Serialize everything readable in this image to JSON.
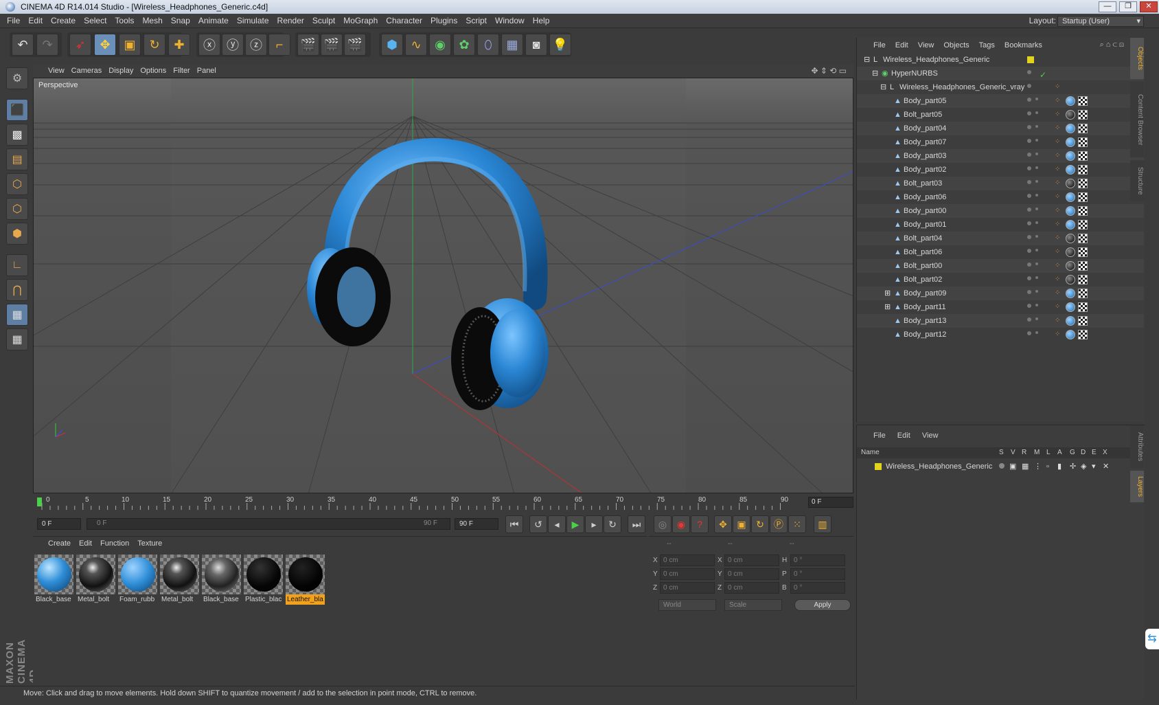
{
  "window": {
    "title": "CINEMA 4D R14.014 Studio - [Wireless_Headphones_Generic.c4d]",
    "minimize": "—",
    "maximize": "❐",
    "close": "✕"
  },
  "menu": [
    "File",
    "Edit",
    "Create",
    "Select",
    "Tools",
    "Mesh",
    "Snap",
    "Animate",
    "Simulate",
    "Render",
    "Sculpt",
    "MoGraph",
    "Character",
    "Plugins",
    "Script",
    "Window",
    "Help"
  ],
  "layout": {
    "label": "Layout:",
    "value": "Startup (User)"
  },
  "viewport": {
    "menu": [
      "View",
      "Cameras",
      "Display",
      "Options",
      "Filter",
      "Panel"
    ],
    "label": "Perspective"
  },
  "timeline": {
    "ticks": [
      "0",
      "5",
      "10",
      "15",
      "20",
      "25",
      "30",
      "35",
      "40",
      "45",
      "50",
      "55",
      "60",
      "65",
      "70",
      "75",
      "80",
      "85",
      "90"
    ],
    "current_frame": "0 F"
  },
  "transport": {
    "start": "0 F",
    "range_start": "0 F",
    "range_end": "90 F",
    "end": "90 F"
  },
  "materials": {
    "menu": [
      "Create",
      "Edit",
      "Function",
      "Texture"
    ],
    "items": [
      {
        "name": "Black_base",
        "color": "#2f8fd8"
      },
      {
        "name": "Metal_bolt",
        "color": "#1a1a1a"
      },
      {
        "name": "Foam_rubb",
        "color": "#2f8fd8"
      },
      {
        "name": "Metal_bolt",
        "color": "#1a1a1a"
      },
      {
        "name": "Black_base",
        "color": "#333333"
      },
      {
        "name": "Plastic_blac",
        "color": "#050505"
      },
      {
        "name": "Leather_bla",
        "color": "#050505"
      }
    ],
    "selected_index": 6
  },
  "coords": {
    "headers": [
      "--",
      "--",
      "--"
    ],
    "rows": [
      {
        "l1": "X",
        "v1": "0 cm",
        "l2": "X",
        "v2": "0 cm",
        "l3": "H",
        "v3": "0 °"
      },
      {
        "l1": "Y",
        "v1": "0 cm",
        "l2": "Y",
        "v2": "0 cm",
        "l3": "P",
        "v3": "0 °"
      },
      {
        "l1": "Z",
        "v1": "0 cm",
        "l2": "Z",
        "v2": "0 cm",
        "l3": "B",
        "v3": "0 °"
      }
    ],
    "mode": "World",
    "transform": "Scale",
    "apply": "Apply"
  },
  "status": "Move: Click and drag to move elements. Hold down SHIFT to quantize movement / add to the selection in point mode, CTRL to remove.",
  "object_manager": {
    "menu": [
      "File",
      "Edit",
      "View",
      "Objects",
      "Tags",
      "Bookmarks"
    ],
    "root": "Wireless_Headphones_Generic",
    "hypernurbs": "HyperNURBS",
    "group": "Wireless_Headphones_Generic_vray",
    "objects": [
      {
        "name": "Body_part05",
        "mat": "blue"
      },
      {
        "name": "Bolt_part05",
        "mat": "black"
      },
      {
        "name": "Body_part04",
        "mat": "blue"
      },
      {
        "name": "Body_part07",
        "mat": "blue"
      },
      {
        "name": "Body_part03",
        "mat": "blue"
      },
      {
        "name": "Body_part02",
        "mat": "blue"
      },
      {
        "name": "Bolt_part03",
        "mat": "black"
      },
      {
        "name": "Body_part06",
        "mat": "blue"
      },
      {
        "name": "Body_part00",
        "mat": "blue"
      },
      {
        "name": "Body_part01",
        "mat": "blue"
      },
      {
        "name": "Bolt_part04",
        "mat": "black"
      },
      {
        "name": "Bolt_part06",
        "mat": "black"
      },
      {
        "name": "Bolt_part00",
        "mat": "black"
      },
      {
        "name": "Bolt_part02",
        "mat": "black"
      },
      {
        "name": "Body_part09",
        "mat": "blue"
      },
      {
        "name": "Body_part11",
        "mat": "blue"
      },
      {
        "name": "Body_part13",
        "mat": "blue"
      },
      {
        "name": "Body_part12",
        "mat": "blue"
      }
    ],
    "side_tabs": [
      "Objects",
      "Content Browser",
      "Structure"
    ]
  },
  "layer_manager": {
    "menu": [
      "File",
      "Edit",
      "View"
    ],
    "columns": [
      "Name",
      "S",
      "V",
      "R",
      "M",
      "L",
      "A",
      "G",
      "D",
      "E",
      "X"
    ],
    "layer": "Wireless_Headphones_Generic",
    "side_tabs": [
      "Attributes",
      "Layers"
    ]
  },
  "logo": "MAXON CINEMA 4D"
}
